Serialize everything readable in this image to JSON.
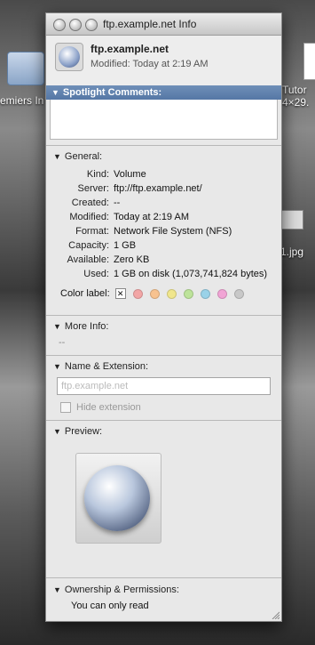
{
  "desktop": {
    "left_label": "emiers In",
    "right_label_1": "Tutor",
    "right_label_2": "4×29.",
    "file_label": "1.jpg"
  },
  "window": {
    "title": "ftp.example.net Info"
  },
  "header": {
    "name": "ftp.example.net",
    "modified": "Modified: Today at 2:19 AM"
  },
  "spotlight": {
    "heading": "Spotlight Comments:"
  },
  "general": {
    "heading": "General:",
    "rows": [
      {
        "label": "Kind:",
        "value": "Volume"
      },
      {
        "label": "Server:",
        "value": "ftp://ftp.example.net/"
      },
      {
        "label": "Created:",
        "value": "--"
      },
      {
        "label": "Modified:",
        "value": "Today at 2:19 AM"
      },
      {
        "label": "Format:",
        "value": "Network File System (NFS)"
      },
      {
        "label": "Capacity:",
        "value": "1 GB"
      },
      {
        "label": "Available:",
        "value": "Zero KB"
      },
      {
        "label": "Used:",
        "value": "1 GB on disk (1,073,741,824 bytes)"
      }
    ],
    "color_label": "Color label:",
    "none_mark": "✕",
    "colors": [
      "#f2a6a6",
      "#f7c28f",
      "#f0e68c",
      "#bde39a",
      "#9ad2e8",
      "#f1a4d5",
      "#c8c8c8"
    ]
  },
  "more_info": {
    "heading": "More Info:",
    "value": "--"
  },
  "name_ext": {
    "heading": "Name & Extension:",
    "value": "ftp.example.net",
    "hide_extension": "Hide extension"
  },
  "preview": {
    "heading": "Preview:"
  },
  "ownership": {
    "heading": "Ownership & Permissions:",
    "value": "You can only read"
  }
}
